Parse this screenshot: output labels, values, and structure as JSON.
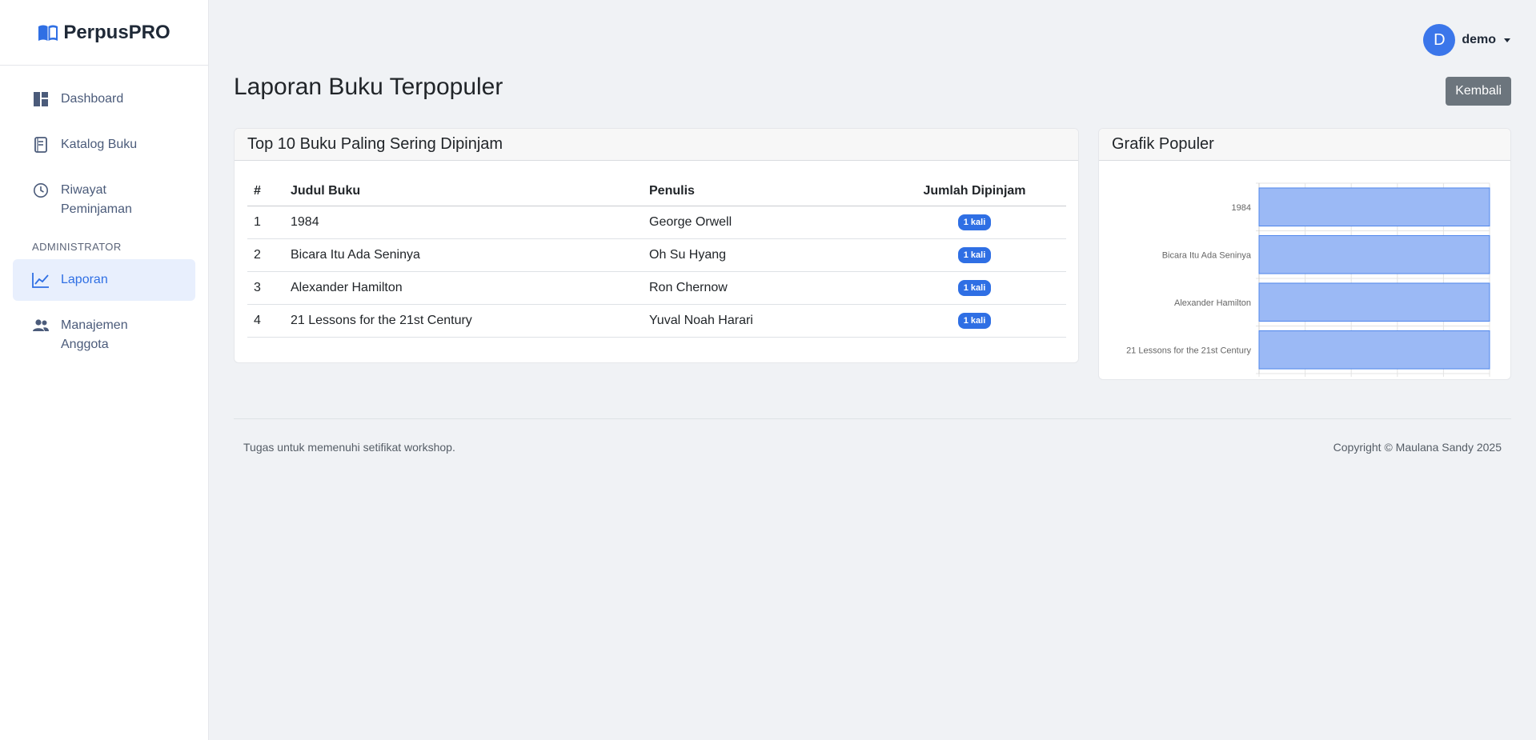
{
  "brand": {
    "name": "PerpusPRO",
    "icon": "book-open-icon",
    "accent": "#2f6fe4"
  },
  "sidebar": {
    "items": [
      {
        "label": "Dashboard",
        "icon": "dashboard-icon"
      },
      {
        "label": "Katalog Buku",
        "icon": "book-icon"
      },
      {
        "label": "Riwayat Peminjaman",
        "icon": "clock-icon"
      }
    ],
    "section_label": "ADMINISTRATOR",
    "admin_items": [
      {
        "label": "Laporan",
        "icon": "chart-line-icon",
        "active": true
      },
      {
        "label": "Manajemen Anggota",
        "icon": "users-icon"
      }
    ]
  },
  "user": {
    "initial": "D",
    "name": "demo"
  },
  "page": {
    "title": "Laporan Buku Terpopuler",
    "back_label": "Kembali"
  },
  "table_card": {
    "title": "Top 10 Buku Paling Sering Dipinjam",
    "headers": [
      "#",
      "Judul Buku",
      "Penulis",
      "Jumlah Dipinjam"
    ],
    "rows": [
      {
        "no": "1",
        "title": "1984",
        "author": "George Orwell",
        "count": "1 kali"
      },
      {
        "no": "2",
        "title": "Bicara Itu Ada Seninya",
        "author": "Oh Su Hyang",
        "count": "1 kali"
      },
      {
        "no": "3",
        "title": "Alexander Hamilton",
        "author": "Ron Chernow",
        "count": "1 kali"
      },
      {
        "no": "4",
        "title": "21 Lessons for the 21st Century",
        "author": "Yuval Noah Harari",
        "count": "1 kali"
      }
    ]
  },
  "chart_card": {
    "title": "Grafik Populer"
  },
  "chart_data": {
    "type": "bar",
    "orientation": "horizontal",
    "categories": [
      "1984",
      "Bicara Itu Ada Seninya",
      "Alexander Hamilton",
      "21 Lessons for the 21st Century"
    ],
    "values": [
      1,
      1,
      1,
      1
    ],
    "xlim": [
      0,
      1
    ],
    "xticks": [
      "0",
      "0.2",
      "0.4",
      "0.6",
      "0.8",
      "1.0"
    ],
    "grid": true,
    "bar_color": "#9bb9f5",
    "bar_border_color": "#4f86ec"
  },
  "footer": {
    "left": "Tugas untuk memenuhi setifikat workshop.",
    "right": "Copyright © Maulana Sandy 2025"
  }
}
